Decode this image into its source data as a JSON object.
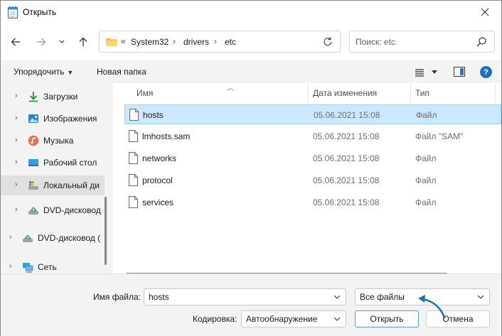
{
  "window": {
    "title": "Открыть",
    "close_glyph": "✕"
  },
  "nav": {
    "back_glyph": "←",
    "forward_glyph": "→",
    "recent_glyph": "⌄",
    "up_glyph": "↑",
    "overflow_glyph": "«",
    "crumbs": [
      "System32",
      "drivers",
      "etc"
    ],
    "crumb_sep": "›",
    "search_placeholder": "Поиск: etc"
  },
  "toolbar": {
    "organize_label": "Упорядочить",
    "new_folder_label": "Новая папка",
    "help_glyph": "?"
  },
  "sidebar": {
    "items": [
      {
        "label": "Загрузки",
        "icon": "download-icon"
      },
      {
        "label": "Изображения",
        "icon": "pictures-icon"
      },
      {
        "label": "Музыка",
        "icon": "music-icon"
      },
      {
        "label": "Рабочий стол",
        "icon": "desktop-icon"
      },
      {
        "label": "Локальный ди",
        "icon": "local-disk-icon",
        "selected": true
      },
      {
        "label": "DVD-дисковод",
        "icon": "dvd-drive-icon"
      },
      {
        "label": "DVD-дисковод (",
        "icon": "dvd-drive-icon"
      },
      {
        "label": "Сеть",
        "icon": "network-icon"
      }
    ]
  },
  "columns": {
    "name": "Имя",
    "date": "Дата изменения",
    "type": "Тип"
  },
  "files": [
    {
      "name": "hosts",
      "date": "05.06.2021 15:08",
      "type": "Файл",
      "selected": true
    },
    {
      "name": "lmhosts.sam",
      "date": "05.06.2021 15:08",
      "type": "Файл \"SAM\""
    },
    {
      "name": "networks",
      "date": "05.06.2021 15:08",
      "type": "Файл"
    },
    {
      "name": "protocol",
      "date": "05.06.2021 15:08",
      "type": "Файл"
    },
    {
      "name": "services",
      "date": "05.06.2021 15:08",
      "type": "Файл"
    }
  ],
  "bottom": {
    "filename_label": "Имя файла:",
    "filename_value": "hosts",
    "filter_value": "Все файлы",
    "encoding_label": "Кодировка:",
    "encoding_value": "Автообнаружение",
    "open_label": "Открыть",
    "cancel_label": "Отмена"
  },
  "colors": {
    "selection_fill": "#cce8ff",
    "selection_border": "#99d1ff",
    "accent": "#0067c0",
    "annotation_arrow": "#1e6fb8"
  }
}
